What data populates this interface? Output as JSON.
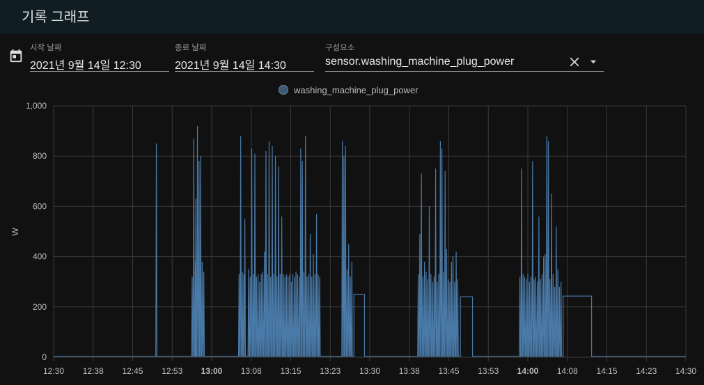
{
  "page": {
    "title": "기록 그래프"
  },
  "filters": {
    "start": {
      "label": "시작 날짜",
      "value": "2021년 9월 14일 12:30"
    },
    "end": {
      "label": "종료 날짜",
      "value": "2021년 9월 14일 14:30"
    },
    "entity": {
      "label": "구성요소",
      "value": "sensor.washing_machine_plug_power"
    }
  },
  "icons": {
    "calendar": "calendar-icon",
    "clear": "close-icon",
    "dropdown": "menu-down-icon"
  },
  "colors": {
    "series": "#4a7aa8",
    "header": "#101e24",
    "background": "#111111"
  },
  "chart_data": {
    "type": "line",
    "ylabel": "W",
    "ylim": [
      0,
      1000
    ],
    "xlim": [
      0,
      120
    ],
    "grid": true,
    "legend_position": "top",
    "x_unit": "minutes after 12:30",
    "y_ticks": [
      "0",
      "200",
      "400",
      "600",
      "800",
      "1,000"
    ],
    "x_ticks": [
      {
        "label": "12:30",
        "bold": false
      },
      {
        "label": "12:38",
        "bold": false
      },
      {
        "label": "12:45",
        "bold": false
      },
      {
        "label": "12:53",
        "bold": false
      },
      {
        "label": "13:00",
        "bold": true
      },
      {
        "label": "13:08",
        "bold": false
      },
      {
        "label": "13:15",
        "bold": false
      },
      {
        "label": "13:23",
        "bold": false
      },
      {
        "label": "13:30",
        "bold": false
      },
      {
        "label": "13:38",
        "bold": false
      },
      {
        "label": "13:45",
        "bold": false
      },
      {
        "label": "13:53",
        "bold": false
      },
      {
        "label": "14:00",
        "bold": true
      },
      {
        "label": "14:08",
        "bold": false
      },
      {
        "label": "14:15",
        "bold": false
      },
      {
        "label": "14:23",
        "bold": false
      },
      {
        "label": "14:30",
        "bold": false
      }
    ],
    "series": [
      {
        "name": "washing_machine_plug_power",
        "color": "#4a7aa8",
        "baseline": 3,
        "plateaus": [
          {
            "x0": 57.0,
            "x1": 59.0,
            "y": 250
          },
          {
            "x0": 77.2,
            "x1": 79.5,
            "y": 240
          },
          {
            "x0": 96.7,
            "x1": 102.1,
            "y": 243
          }
        ],
        "spikes": [
          [
            19.5,
            850
          ],
          [
            26.3,
            320
          ],
          [
            26.6,
            870
          ],
          [
            26.9,
            380
          ],
          [
            27.0,
            630
          ],
          [
            27.3,
            920
          ],
          [
            27.6,
            780
          ],
          [
            27.9,
            800
          ],
          [
            28.2,
            380
          ],
          [
            28.5,
            340
          ],
          [
            35.2,
            330
          ],
          [
            35.5,
            880
          ],
          [
            35.8,
            340
          ],
          [
            36.1,
            330
          ],
          [
            36.3,
            550
          ],
          [
            37.0,
            350
          ],
          [
            37.3,
            320
          ],
          [
            37.6,
            830
          ],
          [
            37.9,
            330
          ],
          [
            38.2,
            810
          ],
          [
            38.5,
            320
          ],
          [
            38.8,
            330
          ],
          [
            39.1,
            300
          ],
          [
            39.4,
            330
          ],
          [
            39.7,
            340
          ],
          [
            40.0,
            420
          ],
          [
            40.3,
            820
          ],
          [
            40.6,
            330
          ],
          [
            40.9,
            860
          ],
          [
            41.2,
            320
          ],
          [
            41.5,
            840
          ],
          [
            41.8,
            330
          ],
          [
            42.1,
            800
          ],
          [
            42.4,
            320
          ],
          [
            42.7,
            760
          ],
          [
            43.0,
            330
          ],
          [
            43.3,
            560
          ],
          [
            43.6,
            330
          ],
          [
            43.9,
            320
          ],
          [
            44.2,
            330
          ],
          [
            44.5,
            320
          ],
          [
            44.8,
            330
          ],
          [
            45.1,
            300
          ],
          [
            45.4,
            330
          ],
          [
            45.7,
            320
          ],
          [
            46.0,
            340
          ],
          [
            46.3,
            330
          ],
          [
            46.6,
            320
          ],
          [
            46.9,
            830
          ],
          [
            47.2,
            780
          ],
          [
            47.5,
            340
          ],
          [
            47.8,
            880
          ],
          [
            48.1,
            320
          ],
          [
            48.4,
            330
          ],
          [
            48.7,
            490
          ],
          [
            49.0,
            320
          ],
          [
            49.3,
            410
          ],
          [
            49.6,
            330
          ],
          [
            49.9,
            570
          ],
          [
            50.2,
            330
          ],
          [
            50.5,
            320
          ],
          [
            54.8,
            860
          ],
          [
            55.1,
            800
          ],
          [
            55.4,
            840
          ],
          [
            55.7,
            350
          ],
          [
            56.0,
            450
          ],
          [
            56.3,
            320
          ],
          [
            56.6,
            380
          ],
          [
            69.2,
            330
          ],
          [
            69.5,
            490
          ],
          [
            69.8,
            730
          ],
          [
            70.1,
            320
          ],
          [
            70.4,
            380
          ],
          [
            70.7,
            340
          ],
          [
            71.0,
            310
          ],
          [
            71.3,
            600
          ],
          [
            71.6,
            330
          ],
          [
            71.9,
            300
          ],
          [
            72.2,
            320
          ],
          [
            72.5,
            750
          ],
          [
            72.8,
            300
          ],
          [
            73.1,
            330
          ],
          [
            73.4,
            860
          ],
          [
            73.7,
            830
          ],
          [
            74.0,
            340
          ],
          [
            74.3,
            740
          ],
          [
            74.6,
            430
          ],
          [
            74.9,
            310
          ],
          [
            75.2,
            300
          ],
          [
            75.5,
            380
          ],
          [
            75.8,
            400
          ],
          [
            76.1,
            300
          ],
          [
            76.4,
            420
          ],
          [
            76.7,
            310
          ],
          [
            88.5,
            320
          ],
          [
            88.8,
            750
          ],
          [
            89.1,
            330
          ],
          [
            89.4,
            320
          ],
          [
            89.7,
            310
          ],
          [
            90.0,
            330
          ],
          [
            90.3,
            300
          ],
          [
            90.6,
            320
          ],
          [
            90.9,
            780
          ],
          [
            91.2,
            310
          ],
          [
            91.5,
            320
          ],
          [
            91.8,
            300
          ],
          [
            92.1,
            560
          ],
          [
            92.4,
            310
          ],
          [
            92.7,
            330
          ],
          [
            93.0,
            400
          ],
          [
            93.3,
            410
          ],
          [
            93.6,
            880
          ],
          [
            93.9,
            860
          ],
          [
            94.2,
            310
          ],
          [
            94.5,
            650
          ],
          [
            94.8,
            330
          ],
          [
            95.1,
            280
          ],
          [
            95.4,
            520
          ],
          [
            95.7,
            350
          ],
          [
            96.0,
            280
          ],
          [
            96.3,
            300
          ]
        ]
      }
    ]
  }
}
